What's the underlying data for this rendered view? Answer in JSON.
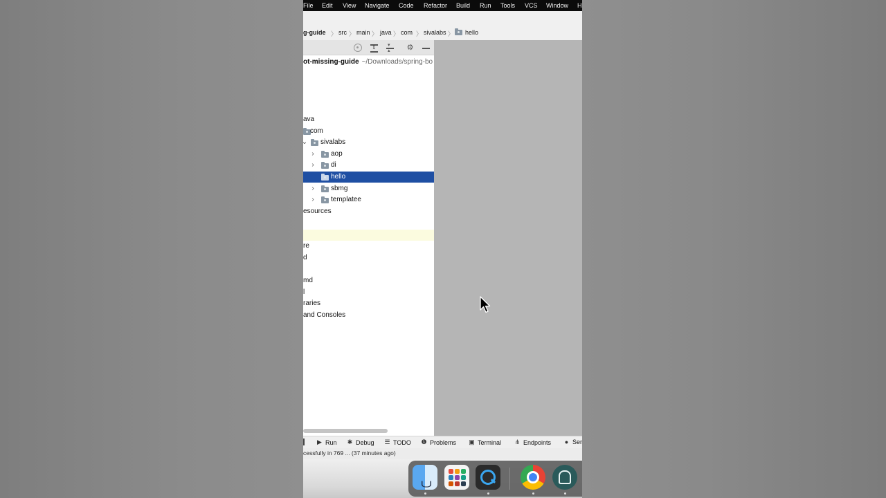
{
  "menubar": {
    "items": [
      "File",
      "Edit",
      "View",
      "Navigate",
      "Code",
      "Refactor",
      "Build",
      "Run",
      "Tools",
      "VCS",
      "Window",
      "H"
    ]
  },
  "breadcrumb": {
    "items": [
      "g-guide",
      "src",
      "main",
      "java",
      "com",
      "sivalabs",
      "hello"
    ]
  },
  "project": {
    "root_name": "ot-missing-guide",
    "root_path": "~/Downloads/spring-bo",
    "rows": [
      {
        "label": "",
        "indent": 0
      },
      {
        "label": "ava",
        "indent": 0
      },
      {
        "label": "com",
        "indent": 1
      },
      {
        "label": "sivalabs",
        "indent": 2
      },
      {
        "label": "aop",
        "indent": 3
      },
      {
        "label": "di",
        "indent": 3
      },
      {
        "label": "hello",
        "indent": 3,
        "selected": true
      },
      {
        "label": "sbmg",
        "indent": 3
      },
      {
        "label": "templatee",
        "indent": 3
      },
      {
        "label": "esources",
        "indent": 0
      },
      {
        "label": "re",
        "indent": 0
      },
      {
        "label": "d",
        "indent": 0
      },
      {
        "label": "md",
        "indent": 0
      },
      {
        "label": "l",
        "indent": 0
      },
      {
        "label": "raries",
        "indent": 0
      },
      {
        "label": "and Consoles",
        "indent": 0
      }
    ]
  },
  "tool_windows": [
    {
      "label": "Run",
      "icon": "play-icon"
    },
    {
      "label": "Debug",
      "icon": "bug-icon"
    },
    {
      "label": "TODO",
      "icon": "list-icon"
    },
    {
      "label": "Problems",
      "icon": "info-icon"
    },
    {
      "label": "Terminal",
      "icon": "terminal-icon"
    },
    {
      "label": "Endpoints",
      "icon": "endpoints-icon"
    },
    {
      "label": "Ser",
      "icon": "services-icon"
    }
  ],
  "status": {
    "text": "cessfully in 769 ... (37 minutes ago)"
  },
  "dock": {
    "apps": [
      "finder-icon",
      "launchpad-icon",
      "quicktime-icon",
      "chrome-icon",
      "recorder-icon"
    ]
  },
  "colors": {
    "selection": "#1f4fa3",
    "editor_bg": "#b5b5b5",
    "menubar_bg": "#0b0b0b"
  }
}
